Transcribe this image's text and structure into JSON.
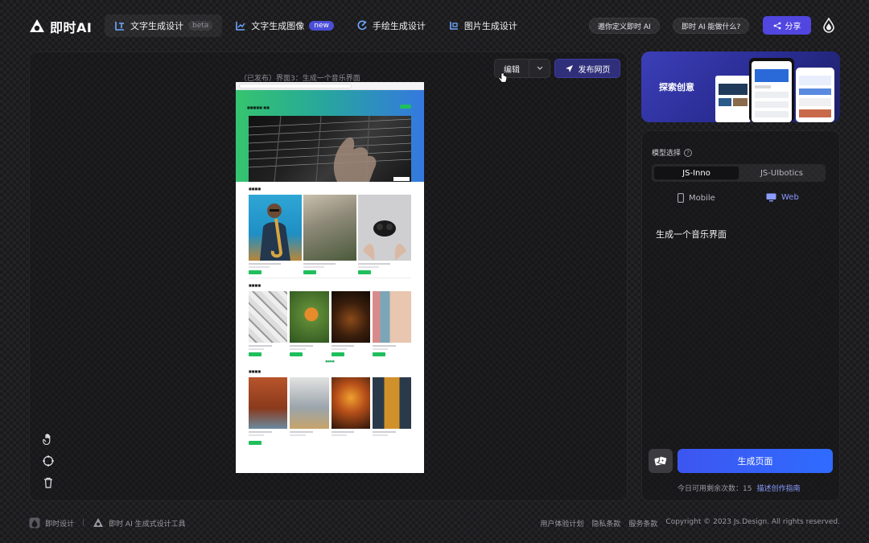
{
  "header": {
    "logo_text": "即时AI",
    "nav": [
      {
        "label": "文字生成设计",
        "badge": "beta"
      },
      {
        "label": "文字生成图像",
        "badge": "new"
      },
      {
        "label": "手绘生成设计",
        "badge": ""
      },
      {
        "label": "图片生成设计",
        "badge": ""
      }
    ],
    "invite_label": "邀你定义即时 AI",
    "about_label": "即时 AI 能做什么?",
    "share_label": "分享"
  },
  "canvas": {
    "preview_label": "（已发布）界面3：生成一个音乐界面",
    "edit_label": "编辑",
    "publish_label": "发布网页"
  },
  "right_panel": {
    "banner_text": "探索创意",
    "model_label": "模型选择",
    "help_glyph": "?",
    "models": [
      "JS-Inno",
      "JS-UIbotics"
    ],
    "selected_model": "JS-Inno",
    "devices": [
      "Mobile",
      "Web"
    ],
    "selected_device": "Web",
    "prompt_text": "生成一个音乐界面",
    "generate_label": "生成页面",
    "quota_text": "今日可用剩余次数：15",
    "guide_link": "描述创作指南"
  },
  "footer": {
    "brand1": "即时设计",
    "brand2": "即时 AI 生成式设计工具",
    "links": [
      "用户体验计划",
      "隐私条款",
      "服务条款"
    ],
    "copyright": "Copyright © 2023 Js.Design. All rights reserved."
  },
  "colors": {
    "accent": "#5146e0",
    "generate": "#2f6bff",
    "preview_green": "#1fbf5c",
    "selected_device": "#8a9cff"
  }
}
